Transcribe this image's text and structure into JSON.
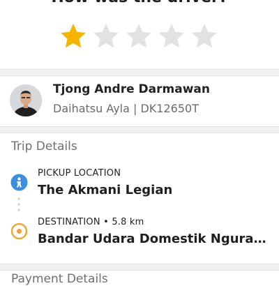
{
  "rating": {
    "title": "How was the driver?",
    "value": 1,
    "max": 5,
    "filled_color": "#f5b400",
    "empty_color": "#e2e2e2"
  },
  "driver": {
    "name": "Tjong Andre Darmawan",
    "vehicle": "Daihatsu Ayla  | DK12650T"
  },
  "trip": {
    "section_title": "Trip Details",
    "pickup": {
      "label": "PICKUP LOCATION",
      "value": "The Akmani Legian",
      "icon": "pickup-location-icon",
      "color": "#3e8ede"
    },
    "destination": {
      "label": "DESTINATION • 5.8 km",
      "value": "Bandar Udara Domestik Ngurah Rai",
      "icon": "destination-icon",
      "color": "#f2a23a"
    }
  },
  "next_section": {
    "title": "Payment Details"
  }
}
